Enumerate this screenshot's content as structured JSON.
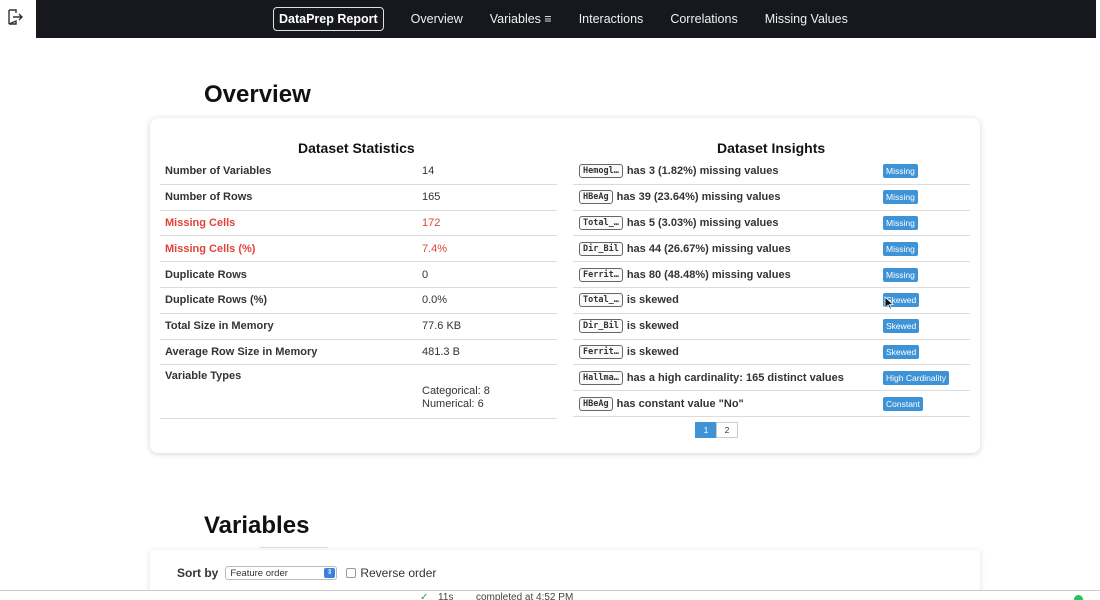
{
  "navbar": {
    "brand": "DataPrep Report",
    "links": [
      "Overview",
      "Variables ≡",
      "Interactions",
      "Correlations",
      "Missing Values"
    ]
  },
  "overview": {
    "title": "Overview",
    "stats_heading": "Dataset Statistics",
    "insights_heading": "Dataset Insights",
    "stats": [
      {
        "label": "Number of Variables",
        "value": "14"
      },
      {
        "label": "Number of Rows",
        "value": "165"
      },
      {
        "label": "Missing Cells",
        "value": "172"
      },
      {
        "label": "Missing Cells (%)",
        "value": "7.4%"
      },
      {
        "label": "Duplicate Rows",
        "value": "0"
      },
      {
        "label": "Duplicate Rows (%)",
        "value": "0.0%"
      },
      {
        "label": "Total Size in Memory",
        "value": "77.6 KB"
      },
      {
        "label": "Average Row Size in Memory",
        "value": "481.3 B"
      },
      {
        "label": "Variable Types",
        "value_line1": "Categorical: 8",
        "value_line2": "Numerical: 6"
      }
    ],
    "insights": [
      {
        "col": "Hemogl…",
        "text": "has 3 (1.82%) missing values",
        "badge": "Missing"
      },
      {
        "col": "HBeAg",
        "text": "has 39 (23.64%) missing values",
        "badge": "Missing"
      },
      {
        "col": "Total_…",
        "text": "has 5 (3.03%) missing values",
        "badge": "Missing"
      },
      {
        "col": "Dir_Bil",
        "text": "has 44 (26.67%) missing values",
        "badge": "Missing"
      },
      {
        "col": "Ferrit…",
        "text": "has 80 (48.48%) missing values",
        "badge": "Missing"
      },
      {
        "col": "Total_…",
        "text": "is skewed",
        "badge": "Skewed"
      },
      {
        "col": "Dir_Bil",
        "text": "is skewed",
        "badge": "Skewed"
      },
      {
        "col": "Ferrit…",
        "text": "is skewed",
        "badge": "Skewed"
      },
      {
        "col": "Hallma…",
        "text": "has a high cardinality: 165 distinct values",
        "badge": "High Cardinality"
      },
      {
        "col": "HBeAg",
        "text": "has constant value \"No\"",
        "badge": "Constant"
      }
    ],
    "pager": [
      "1",
      "2"
    ]
  },
  "variables": {
    "title": "Variables",
    "sort_label": "Sort by",
    "sort_value": "Feature order",
    "reverse_label": "Reverse order"
  },
  "status": {
    "check": "✓",
    "time": "11s",
    "completed": "completed at 4:52 PM"
  },
  "colors": {
    "navbar_bg": "#16181d",
    "badge_bg": "#3e93d6",
    "alert_text": "#e0433a"
  }
}
